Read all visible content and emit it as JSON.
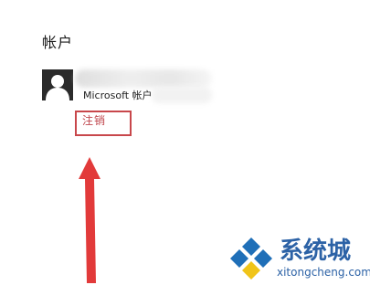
{
  "section": {
    "title": "帐户"
  },
  "account": {
    "type_label": "Microsoft 帐户",
    "avatar_icon": "user-avatar-icon"
  },
  "actions": {
    "signout_label": "注销",
    "highlight_color": "#c8474b",
    "link_color": "#c0474e"
  },
  "annotation": {
    "arrow_color": "#e23a3a"
  },
  "watermark": {
    "brand": "系统城",
    "domain": "xitongcheng.com",
    "brand_color": "#2c62a6"
  }
}
